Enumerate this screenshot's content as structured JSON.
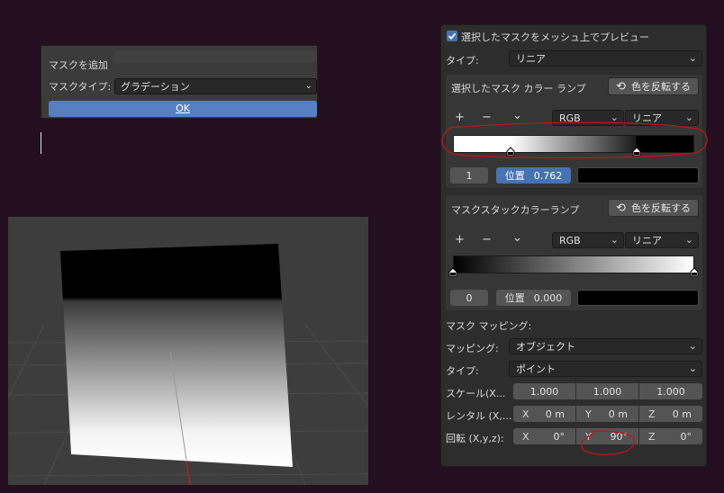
{
  "popup": {
    "title": "マスクを追加",
    "mask_type_label": "マスクタイプ:",
    "mask_type_value": "グラデーション",
    "ok_label": "OK"
  },
  "panel": {
    "preview_checkbox_label": "選択したマスクをメッシュ上でプレビュー",
    "preview_checked": true,
    "type_label": "タイプ:",
    "type_value": "リニア",
    "ramp1": {
      "title": "選択したマスク カラー ランプ",
      "invert_label": "色を反転する",
      "add": "+",
      "remove": "−",
      "more": "⌄",
      "color_mode": "RGB",
      "interpolation": "リニア",
      "index": "1",
      "position_label": "位置",
      "position_value": "0.762",
      "stop_positions": [
        0.24,
        0.762
      ]
    },
    "ramp2": {
      "title": "マスクスタックカラーランプ",
      "invert_label": "色を反転する",
      "add": "+",
      "remove": "−",
      "more": "⌄",
      "color_mode": "RGB",
      "interpolation": "リニア",
      "index": "0",
      "position_label": "位置",
      "position_value": "0.000",
      "stop_positions": [
        0.0,
        1.0
      ]
    },
    "mapping": {
      "section_label": "マスク マッピング:",
      "mapping_label": "マッピング:",
      "mapping_value": "オブジェクト",
      "type_label": "タイプ:",
      "type_value": "ポイント",
      "scale_label": "スケール(X...",
      "scale_values": [
        "1.000",
        "1.000",
        "1.000"
      ],
      "location_label": "レンタル (X,...",
      "location_values": [
        {
          "axis": "X",
          "value": "0 m"
        },
        {
          "axis": "Y",
          "value": "0 m"
        },
        {
          "axis": "Z",
          "value": "0 m"
        }
      ],
      "rotation_label": "回転 (X,y,z):",
      "rotation_values": [
        {
          "axis": "X",
          "value": "0°"
        },
        {
          "axis": "Y",
          "value": "90°"
        },
        {
          "axis": "Z",
          "value": "0°"
        }
      ]
    }
  },
  "colors": {
    "background": "#230f1f",
    "panel": "#2d2d2d",
    "accent_blue": "#4772b3",
    "annotation_red": "#c0141b"
  }
}
